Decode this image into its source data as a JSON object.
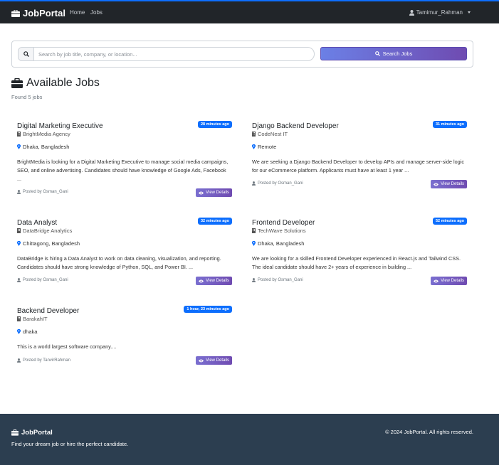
{
  "nav": {
    "brand": "JobPortal",
    "links": [
      "Home",
      "Jobs"
    ],
    "user": "Tamimur_Rahman"
  },
  "search": {
    "placeholder": "Search by job title, company, or location...",
    "button_label": "Search Jobs"
  },
  "main": {
    "title": "Available Jobs",
    "found_text": "Found 5 jobs"
  },
  "jobs": [
    {
      "title": "Digital Marketing Executive",
      "company": "BrightMedia Agency",
      "time": "28 minutes ago",
      "location": "Dhaka, Bangladesh",
      "description": "BrightMedia is looking for a Digital Marketing Executive to manage social media campaigns, SEO, and online advertising. Candidates should have knowledge of Google Ads, Facebook ...",
      "posted_by": "Posted by Osman_Gani",
      "button": "View Details"
    },
    {
      "title": "Django Backend Developer",
      "company": "CodeNest IT",
      "time": "31 minutes ago",
      "location": "Remote",
      "description": "We are seeking a Django Backend Developer to develop APIs and manage server-side logic for our eCommerce platform. Applicants must have at least 1 year ...",
      "posted_by": "Posted by Osman_Gani",
      "button": "View Details"
    },
    {
      "title": "Data Analyst",
      "company": "DataBridge Analytics",
      "time": "32 minutes ago",
      "location": "Chittagong, Bangladesh",
      "description": "DataBridge is hiring a Data Analyst to work on data cleaning, visualization, and reporting. Candidates should have strong knowledge of Python, SQL, and Power BI. ...",
      "posted_by": "Posted by Osman_Gani",
      "button": "View Details"
    },
    {
      "title": "Frontend Developer",
      "company": "TechWave Solutions",
      "time": "52 minutes ago",
      "location": "Dhaka, Bangladesh",
      "description": "We are looking for a skilled Frontend Developer experienced in React.js and Tailwind CSS. The ideal candidate should have 2+ years of experience in building ...",
      "posted_by": "Posted by Osman_Gani",
      "button": "View Details"
    },
    {
      "title": "Backend Developer",
      "company": "BarakahIT",
      "time": "1 hour, 23 minutes ago",
      "location": "dhaka",
      "description": "This is a world largest software company....",
      "posted_by": "Posted by TanvirRahman",
      "button": "View Details"
    }
  ],
  "footer": {
    "brand": "JobPortal",
    "tagline": "Find your dream job or hire the perfect candidate.",
    "copyright": "© 2024 JobPortal. All rights reserved."
  },
  "colors": {
    "navbar": "#212529",
    "accent": "#0d6efd",
    "button_gradient_start": "#6b80e6",
    "button_gradient_end": "#6f4bb1",
    "footer": "#2c3e50"
  },
  "icons": [
    "briefcase-icon",
    "user-icon",
    "search-icon",
    "building-icon",
    "map-pin-icon",
    "eye-icon"
  ]
}
